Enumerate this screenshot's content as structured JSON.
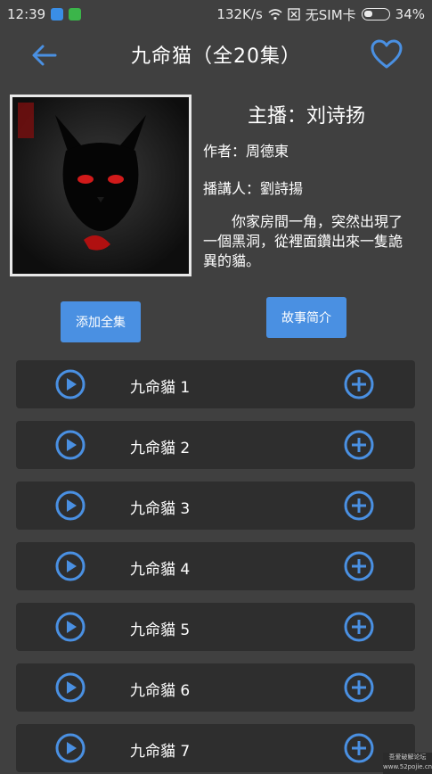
{
  "status": {
    "time": "12:39",
    "network_speed": "132K/s",
    "sim": "无SIM卡",
    "battery": "34%"
  },
  "header": {
    "title": "九命猫（全20集）",
    "back_icon": "arrow-left-icon",
    "favorite_icon": "heart-outline-icon"
  },
  "book": {
    "host": "主播：刘诗扬",
    "author": "作者：周德東",
    "narrator": "播講人：劉詩揚",
    "intro": "你家房間一角，突然出現了一個黑洞，從裡面鑽出來一隻詭異的貓。"
  },
  "actions": {
    "add_all": "添加全集",
    "story_intro": "故事简介"
  },
  "episodes": [
    {
      "title": "九命貓 1"
    },
    {
      "title": "九命貓 2"
    },
    {
      "title": "九命貓 3"
    },
    {
      "title": "九命貓 4"
    },
    {
      "title": "九命貓 5"
    },
    {
      "title": "九命貓 6"
    },
    {
      "title": "九命貓 7"
    }
  ],
  "colors": {
    "background": "#404040",
    "accent": "#4a90e2",
    "row": "#2e2e2e"
  },
  "watermark": {
    "line1": "吾爱破解论坛",
    "line2": "www.52pojie.cn"
  }
}
